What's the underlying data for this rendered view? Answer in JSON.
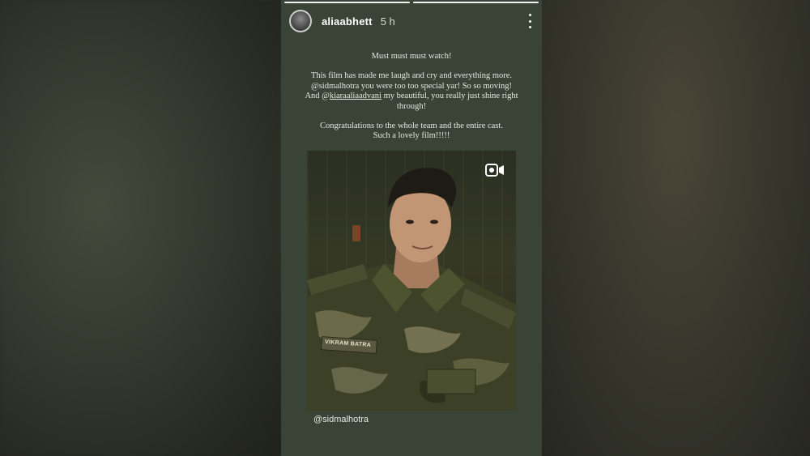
{
  "story": {
    "progress_segments": [
      true,
      true
    ],
    "username": "aliaabhett",
    "time": "5 h",
    "caption": {
      "line1": "Must must must watch!",
      "line2": "This film has made me laugh and cry and everything more.",
      "line3": "@sidmalhotra you were too too special yar! So so moving!",
      "line4_prefix": "And @",
      "line4_link": "kiaraaliaadvani",
      "line4_suffix": " my beautiful, you really just shine right",
      "line5": "through!",
      "line6": "Congratulations to the whole team and the entire cast.",
      "line7": "Such a lovely film!!!!!"
    },
    "photo": {
      "name_tape": "VIKRAM BATRA",
      "mention": "@sidmalhotra"
    },
    "icons": {
      "menu": "more-vertical-icon",
      "reel": "reel-camera-icon"
    }
  }
}
